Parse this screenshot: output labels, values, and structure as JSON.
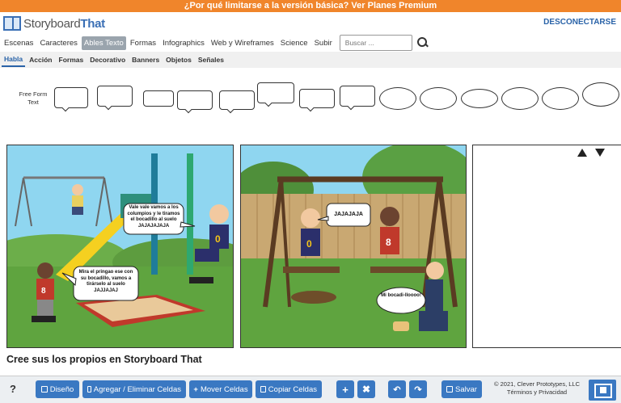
{
  "promo": {
    "text": "¿Por qué limitarse a la versión básica? Ver Planes Premium"
  },
  "header": {
    "logo_story": "Storyboard",
    "logo_that": "That",
    "logout": "DESCONECTARSE"
  },
  "nav_primary": {
    "items": [
      {
        "label": "Escenas",
        "active": false
      },
      {
        "label": "Caracteres",
        "active": false
      },
      {
        "label": "Ables Texto",
        "active": true
      },
      {
        "label": "Formas",
        "active": false
      },
      {
        "label": "Infographics",
        "active": false
      },
      {
        "label": "Web y Wireframes",
        "active": false
      },
      {
        "label": "Science",
        "active": false
      },
      {
        "label": "Subir",
        "active": false
      }
    ],
    "search_placeholder": "Buscar ..."
  },
  "nav_secondary": {
    "items": [
      {
        "label": "Habla",
        "active": true
      },
      {
        "label": "Acción",
        "active": false
      },
      {
        "label": "Formas",
        "active": false
      },
      {
        "label": "Decorativo",
        "active": false
      },
      {
        "label": "Banners",
        "active": false
      },
      {
        "label": "Objetos",
        "active": false
      },
      {
        "label": "Señales",
        "active": false
      }
    ]
  },
  "palette": {
    "freeform_label": "Free Form Text"
  },
  "panels": {
    "panel1": {
      "bubble1": "Vale vale vamos a los columpios y le tiramos el bocadillo al suelo JAJAJAJAJA",
      "bubble2": "Mira el pringao ese con su bocadillo, vamos a tirárselo al suelo JAJJAJAJ"
    },
    "panel2": {
      "bubble1": "JAJAJAJA",
      "bubble2": "Mi bocadi-lloooo!"
    }
  },
  "caption": "Cree sus los propios en Storyboard That",
  "toolbar": {
    "help": "?",
    "layout": "Diseño",
    "add_remove": "Agregar / Eliminar Celdas",
    "move": "Mover Celdas",
    "copy": "Copiar Celdas",
    "save": "Salvar",
    "copyright_line1": "© 2021, Clever Prototypes, LLC",
    "copyright_line2": "Términos y Privacidad"
  },
  "colors": {
    "promo": "#f0852b",
    "brand_blue": "#3a78c2",
    "link_blue": "#2a63a8"
  }
}
